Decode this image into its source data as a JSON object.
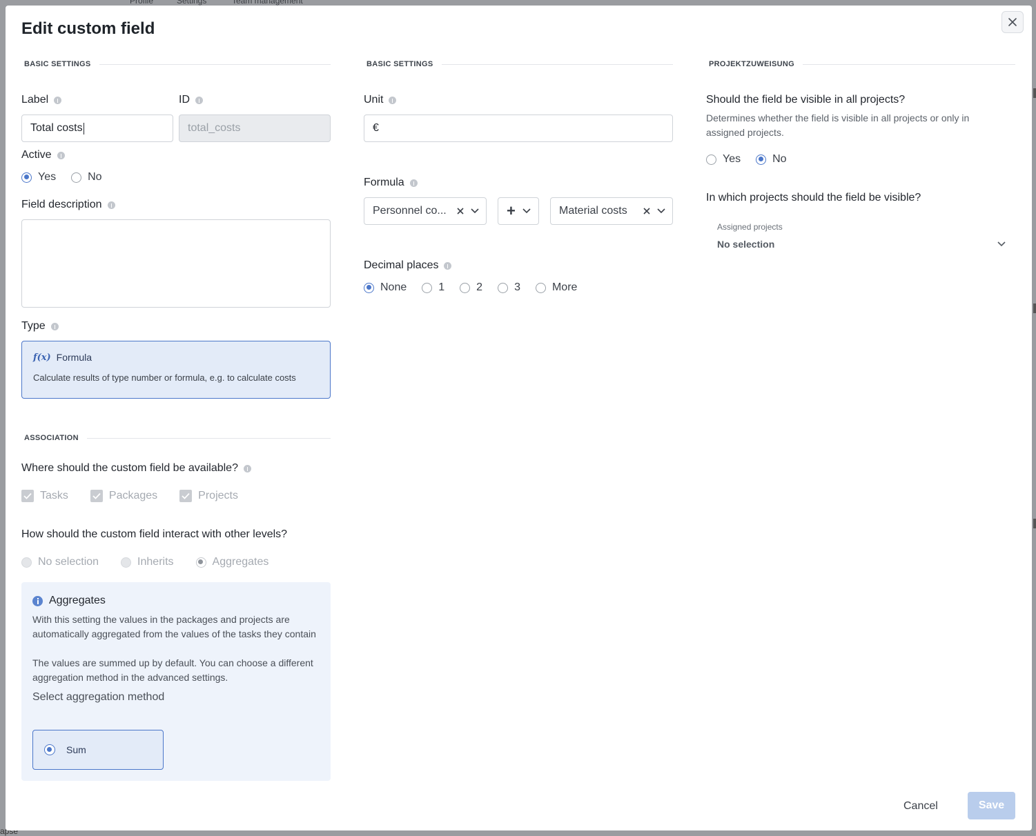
{
  "background": {
    "tabs": [
      "Profile",
      "Settings",
      "Team management"
    ],
    "bottom_text": "apse"
  },
  "modal": {
    "title": "Edit custom field",
    "close_icon": "close-icon"
  },
  "basic_settings_left": {
    "section_title": "BASIC SETTINGS",
    "label_field": {
      "label": "Label",
      "value": "Total costs"
    },
    "id_field": {
      "label": "ID",
      "value": "total_costs"
    },
    "active": {
      "label": "Active",
      "options": [
        "Yes",
        "No"
      ],
      "selected": "Yes"
    },
    "description": {
      "label": "Field description",
      "value": ""
    },
    "type": {
      "label": "Type",
      "card_title": "Formula",
      "card_icon": "f(x)",
      "card_desc": "Calculate results of type number or formula, e.g. to calculate costs"
    }
  },
  "association": {
    "section_title": "ASSOCIATION",
    "availability": {
      "label": "Where should the custom field be available?",
      "options": [
        "Tasks",
        "Packages",
        "Projects"
      ]
    },
    "interaction": {
      "label": "How should the custom field interact with other levels?",
      "options": [
        "No selection",
        "Inherits",
        "Aggregates"
      ],
      "selected": "Aggregates"
    },
    "aggregates_box": {
      "title": "Aggregates",
      "text1": "With this setting the values in the packages and projects are automatically aggregated from the values of the tasks they contain",
      "text2": "The values are summed up by default. You can choose a different aggregation method in the advanced settings.",
      "select_label": "Select aggregation method",
      "method": "Sum"
    }
  },
  "basic_settings_mid": {
    "section_title": "BASIC SETTINGS",
    "unit": {
      "label": "Unit",
      "value": "€"
    },
    "formula": {
      "label": "Formula",
      "operand1": "Personnel co...",
      "operator": "+",
      "operand2": "Material costs"
    },
    "decimal_places": {
      "label": "Decimal places",
      "options": [
        "None",
        "1",
        "2",
        "3",
        "More"
      ],
      "selected": "None"
    }
  },
  "project_assignment": {
    "section_title": "PROJEKTZUWEISUNG",
    "visible_all": {
      "label": "Should the field be visible in all projects?",
      "help": "Determines whether the field is visible in all projects or only in assigned projects.",
      "options": [
        "Yes",
        "No"
      ],
      "selected": "No"
    },
    "which_projects": {
      "label": "In which projects should the field be visible?",
      "select_label": "Assigned projects",
      "select_value": "No selection"
    }
  },
  "footer": {
    "cancel_label": "Cancel",
    "save_label": "Save"
  },
  "colors": {
    "accent": "#4a76c9",
    "card_bg": "#e3ebf8",
    "save_disabled": "#b9cdec"
  }
}
